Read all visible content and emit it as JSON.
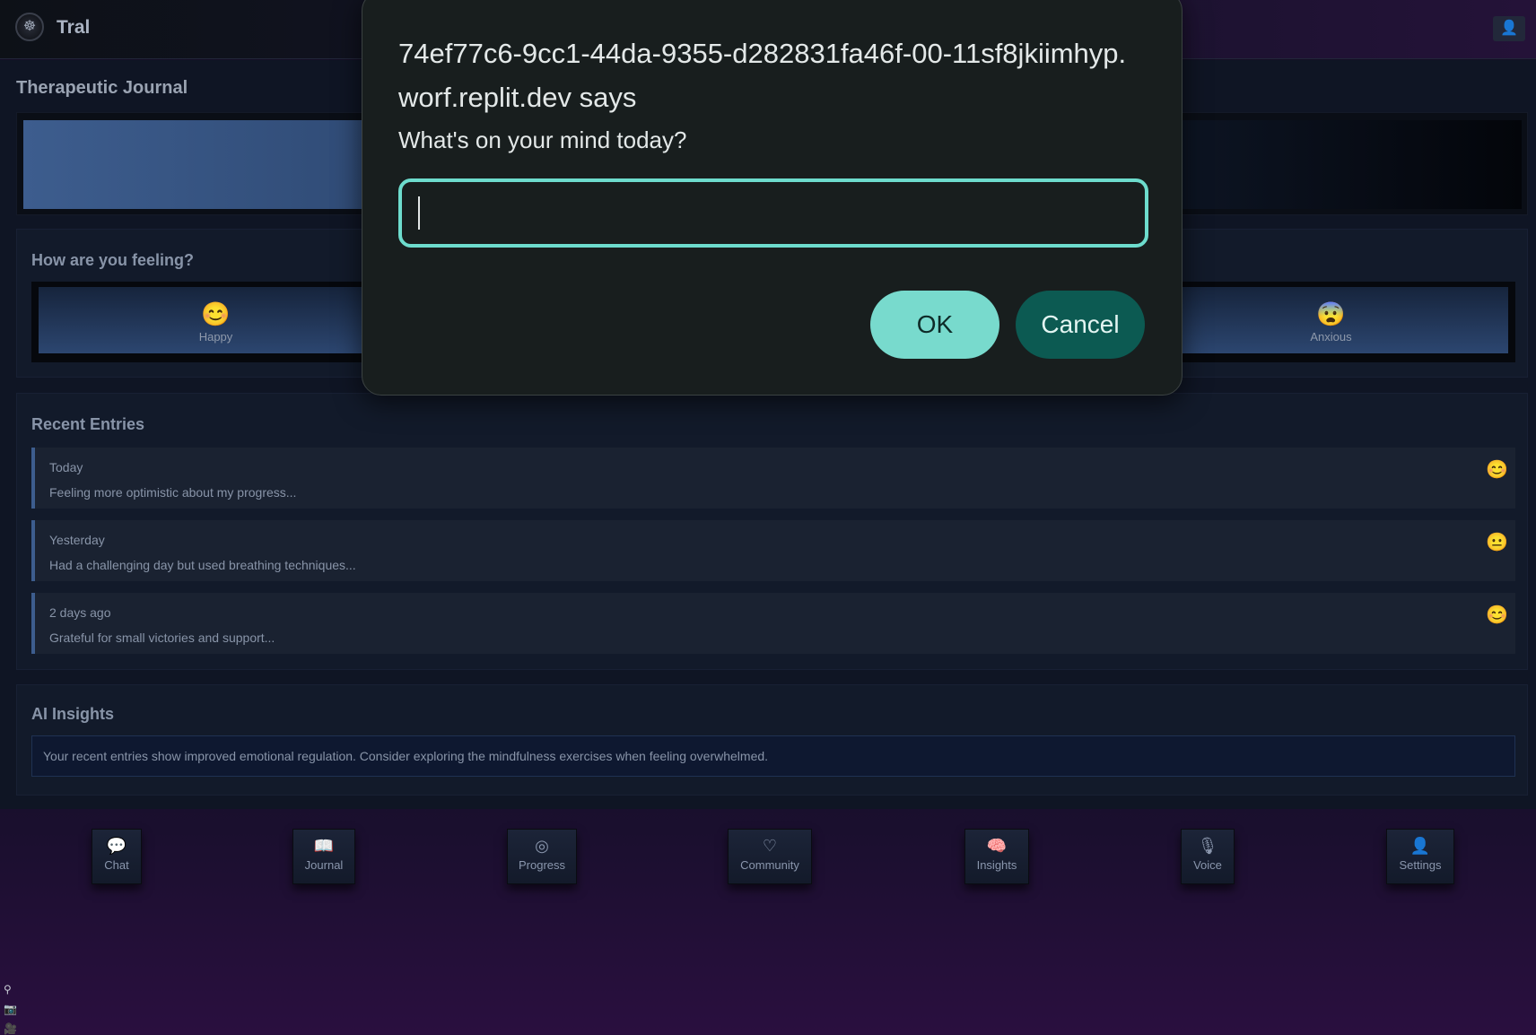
{
  "app": {
    "name": "Tral",
    "logo_glyph": "☸",
    "profile_icon": "👤"
  },
  "page": {
    "title": "Therapeutic Journal"
  },
  "mood_section": {
    "title": "How are you feeling?",
    "moods": [
      {
        "label": "Happy",
        "emoji": "😊"
      },
      {
        "label": "Anxious",
        "emoji": "😨"
      }
    ]
  },
  "recent_entries": {
    "title": "Recent Entries",
    "items": [
      {
        "date": "Today",
        "text": "Feeling more optimistic about my progress...",
        "emoji": "😊"
      },
      {
        "date": "Yesterday",
        "text": "Had a challenging day but used breathing techniques...",
        "emoji": "😐"
      },
      {
        "date": "2 days ago",
        "text": "Grateful for small victories and support...",
        "emoji": "😊"
      }
    ]
  },
  "ai_insights": {
    "title": "AI Insights",
    "text": "Your recent entries show improved emotional regulation. Consider exploring the mindfulness exercises when feeling overwhelmed."
  },
  "bottom_nav": [
    {
      "label": "Chat",
      "icon": "💬"
    },
    {
      "label": "Journal",
      "icon": "📖"
    },
    {
      "label": "Progress",
      "icon": "◎"
    },
    {
      "label": "Community",
      "icon": "♡"
    },
    {
      "label": "Insights",
      "icon": "🧠"
    },
    {
      "label": "Voice",
      "icon": "🎙"
    },
    {
      "label": "Settings",
      "icon": "👤"
    }
  ],
  "dialog": {
    "title": "74ef77c6-9cc1-44da-9355-d282831fa46f-00-11sf8jkiimhyp.worf.replit.dev says",
    "message": "What's on your mind today?",
    "input_value": "",
    "ok_label": "OK",
    "cancel_label": "Cancel"
  },
  "colors": {
    "dialog_accent": "#78dacd",
    "cancel_bg": "#0c5a52",
    "mood_button": "#2c4670"
  }
}
